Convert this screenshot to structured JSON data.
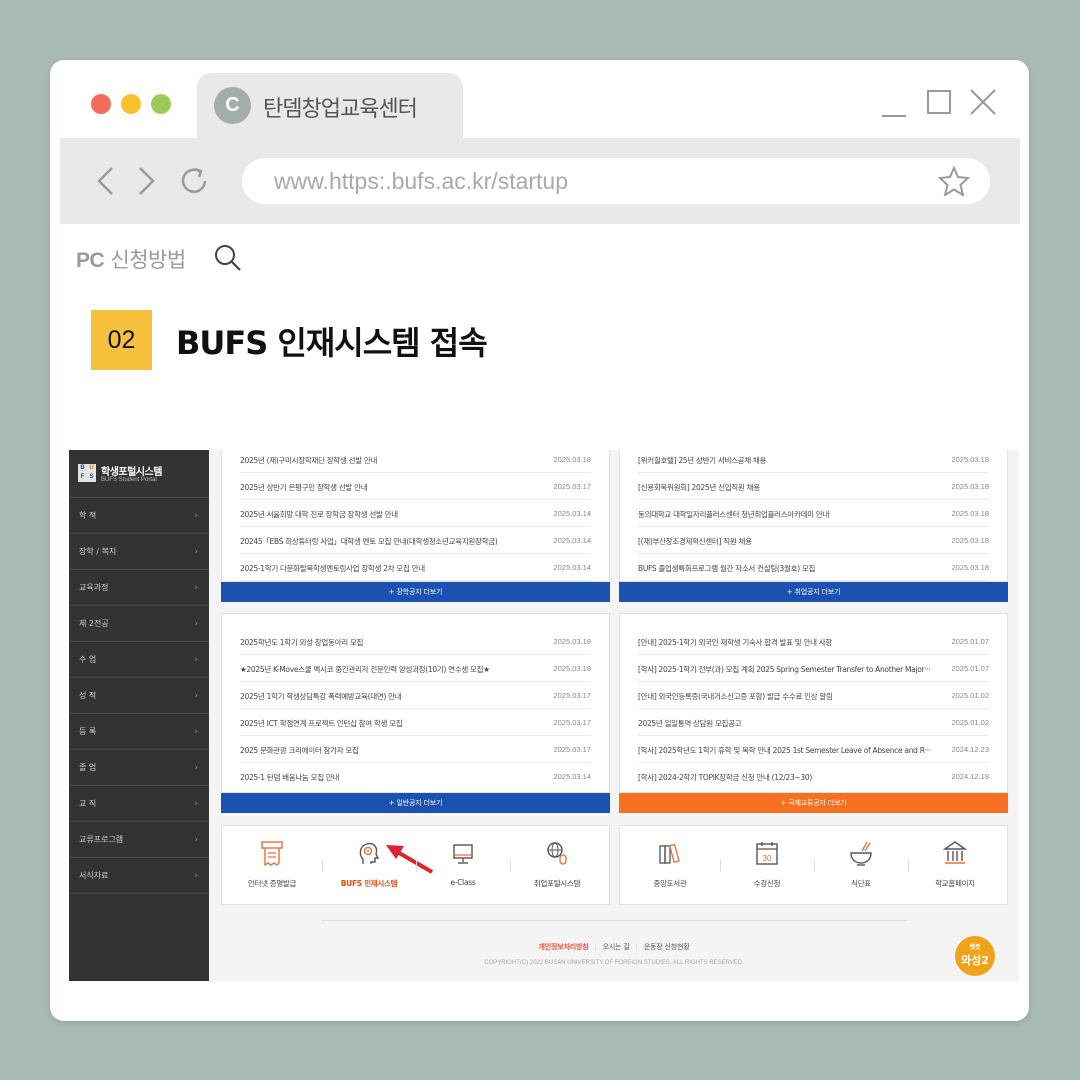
{
  "browser": {
    "tab_icon_letter": "C",
    "tab_title": "탄뎀창업교육센터",
    "url": "www.https:.bufs.ac.kr/startup"
  },
  "heading": {
    "pc_prefix": "PC",
    "pc_label": "신청방법",
    "step_number": "02",
    "step_title": "BUFS 인재시스템 접속"
  },
  "portal": {
    "logo_letters": [
      "B",
      "U",
      "F",
      "S"
    ],
    "name": "학생포털시스템",
    "subtitle": "BUFS Student Portal",
    "menu": [
      "학 적",
      "장학 / 복지",
      "교육과정",
      "제 2전공",
      "수 업",
      "성 적",
      "등 록",
      "졸 업",
      "교 직",
      "교류프로그램",
      "서식자료"
    ]
  },
  "boards": [
    {
      "rows": [
        {
          "title": "2025년 (재)구미시장학재단 장학생 선발 안내",
          "date": "2025.03.18"
        },
        {
          "title": "2025년 상반기 은평구민 장학생 선발 안내",
          "date": "2025.03.17"
        },
        {
          "title": "2025년 서울희망 대학 진로 장학금 장학생 선발 안내",
          "date": "2025.03.14"
        },
        {
          "title": "20245「EBS 희상튜터링 사업」대학생 멘토 모집 안내(대학생청소년교육지원장학금)",
          "date": "2025.03.14"
        },
        {
          "title": "2025-1학기 다문화탈북학생멘토링사업 장학생 2차 모집 안내",
          "date": "2025.03.14"
        }
      ],
      "more": "+ 장학공지 더보기"
    },
    {
      "rows": [
        {
          "title": "[위커힐호텔] 25년 상반기 서비스공채 채용",
          "date": "2025.03.18"
        },
        {
          "title": "[신용회복위원회] 2025년 신입직원 채용",
          "date": "2025.03.18"
        },
        {
          "title": "동의대학교 대학일자리플러스센터 청년취업플러스아카데미 안내",
          "date": "2025.03.18"
        },
        {
          "title": "[(재)부산창조경제혁신센터] 직원 채용",
          "date": "2025.03.18"
        },
        {
          "title": "BUFS 졸업생특화프로그램 월간 자소서 컨설팅(3월호) 모집",
          "date": "2025.03.18"
        }
      ],
      "more": "+ 취업공지 더보기"
    },
    {
      "rows": [
        {
          "title": "2025학년도 1학기 외성 창업동아리 모집",
          "date": "2025.03.18"
        },
        {
          "title": "★2025년 K-Move스쿨 멕시코 중간관리자 전문인력 양성과정(10기) 연수생 모집★",
          "date": "2025.03.18"
        },
        {
          "title": "2025년 1학기 학생상담특강 폭력예방교육(대면) 안내",
          "date": "2025.03.17"
        },
        {
          "title": "2025년 ICT 학점연계 프로젝트 인턴십 참여 학생 모집",
          "date": "2025.03.17"
        },
        {
          "title": "2025 문화관광 크리에이터 참가자 모집",
          "date": "2025.03.17"
        },
        {
          "title": "2025-1 탄뎀 배움나눔 모집 안내",
          "date": "2025.03.14"
        }
      ],
      "more": "+ 일반공지 더보기"
    },
    {
      "rows": [
        {
          "title": "[안내] 2025-1학기 외국인 재학생 기숙사 합격 발표 및 안내 사항",
          "date": "2025.01.07"
        },
        {
          "title": "[학사] 2025-1학기 전부(과) 모집 계획 2025 Spring Semester Transfer to Another Major···",
          "date": "2025.01.07"
        },
        {
          "title": "[안내] 외국인등록증(국내거소신고증 포함) 발급 수수료 인상 알림",
          "date": "2025.01.02"
        },
        {
          "title": "2025년 일일통역 상담원 모집공고",
          "date": "2025.01.02"
        },
        {
          "title": "[학사] 2025학년도 1학기 휴학 및 복학 안내 2025 1st Semester Leave of Absence and R···",
          "date": "2024.12.23"
        },
        {
          "title": "[학사] 2024-2학기 TOPIK장학금 신청 안내 (12/23~30)",
          "date": "2024.12.18"
        }
      ],
      "more": "+ 국제교류공지 더보기"
    }
  ],
  "shortcuts_left": [
    "인터넷 증명발급",
    "BUFS 인재시스템",
    "e-Class",
    "취업포털시스템"
  ],
  "shortcuts_right": [
    "중앙도서관",
    "수강신청",
    "식단표",
    "학교홈페이지"
  ],
  "calendar_day": "30",
  "footer": {
    "privacy": "개인정보처리방침",
    "directions": "오시는 길",
    "field": "운동장 신청현황",
    "copyright": "COPYRIGHT(C) 2022 BUSAN UNIVERSITY OF FOREIGN STUDIES. ALL RIGHTS RESERVED."
  },
  "chatbot": {
    "line1": "챗봇",
    "line2": "와성2"
  },
  "colors": {
    "accent_blue": "#1b52b0",
    "accent_orange": "#f5701f",
    "badge_yellow": "#f6c13c",
    "highlight": "#e84b13"
  }
}
